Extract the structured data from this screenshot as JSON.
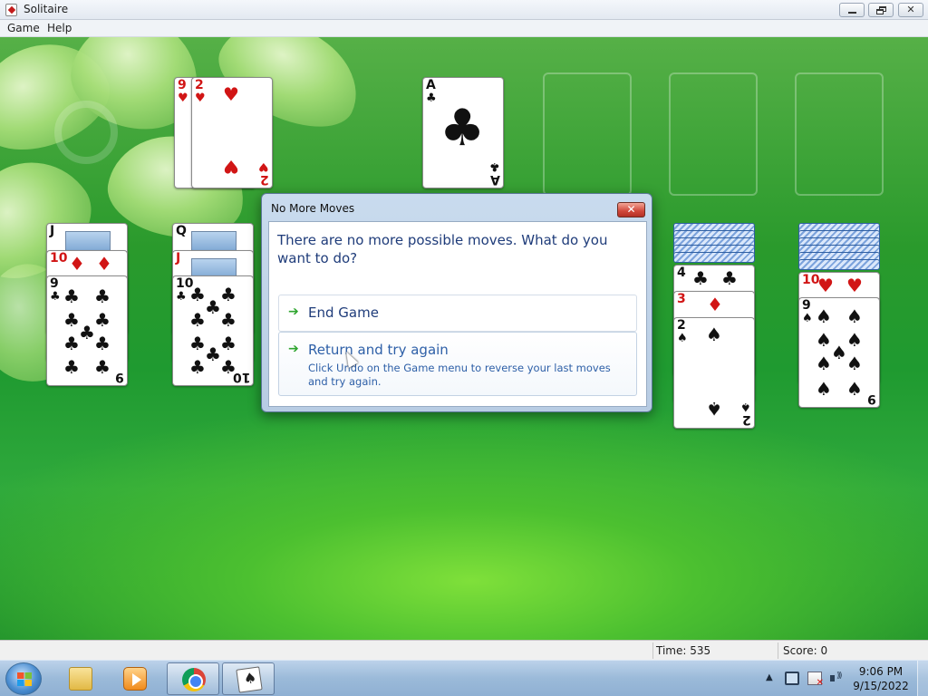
{
  "window": {
    "title": "Solitaire"
  },
  "menu": {
    "game": "Game",
    "help": "Help"
  },
  "waste": {
    "back_card": {
      "rank": "9",
      "suit": "♥"
    },
    "top_card": {
      "rank": "2",
      "suit": "♥"
    }
  },
  "foundation": {
    "card": {
      "rank": "A",
      "suit": "♣"
    }
  },
  "tableau": {
    "col1": {
      "cards": [
        {
          "rank": "J",
          "suit": "♣"
        },
        {
          "rank": "10",
          "suit": "♦"
        },
        {
          "rank": "9",
          "suit": "♣"
        }
      ]
    },
    "col2": {
      "cards": [
        {
          "rank": "Q",
          "suit": "♣"
        },
        {
          "rank": "J",
          "suit": "♥"
        },
        {
          "rank": "10",
          "suit": "♣"
        }
      ]
    },
    "col6": {
      "cards": [
        {
          "rank": "4",
          "suit": "♣"
        },
        {
          "rank": "3",
          "suit": "♦"
        },
        {
          "rank": "2",
          "suit": "♠"
        }
      ]
    },
    "col7": {
      "cards": [
        {
          "rank": "10",
          "suit": "♥"
        },
        {
          "rank": "9",
          "suit": "♠"
        }
      ]
    }
  },
  "dialog": {
    "title": "No More Moves",
    "close_glyph": "✕",
    "message": "There are no more possible moves. What do you want to do?",
    "options": [
      {
        "label": "End Game",
        "note": ""
      },
      {
        "label": "Return and try again",
        "note": "Click Undo on the Game menu to reverse your last moves and try again."
      }
    ],
    "arrow_glyph": "➔"
  },
  "status": {
    "time": "Time:  535",
    "score": "Score: 0"
  },
  "taskbar": {
    "clock_time": "9:06 PM",
    "clock_date": "9/15/2022",
    "tray_arrow": "▲"
  },
  "colors": {
    "felt": "#2a9a2c",
    "dialog_text": "#1f3c7a",
    "link_text": "#2d5fa7",
    "red_suit": "#d11515"
  }
}
